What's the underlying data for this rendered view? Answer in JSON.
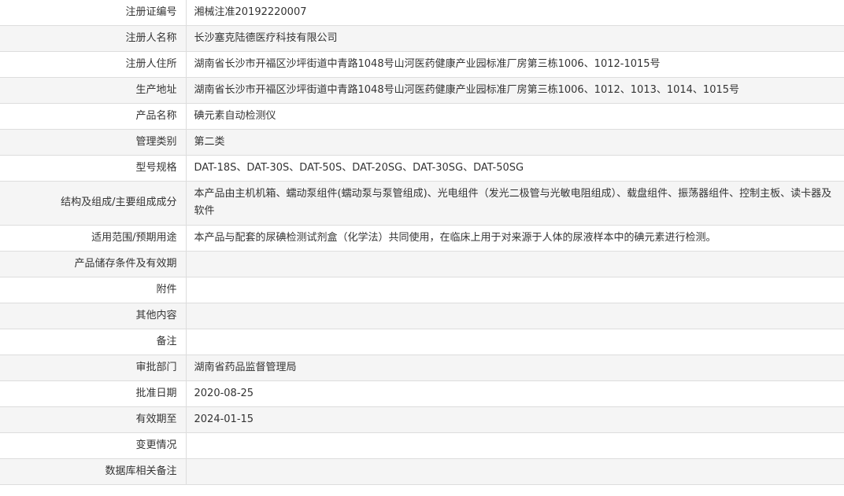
{
  "rows": [
    {
      "label": "注册证编号",
      "value": "湘械注准20192220007"
    },
    {
      "label": "注册人名称",
      "value": "长沙塞克陆德医疗科技有限公司"
    },
    {
      "label": "注册人住所",
      "value": "湖南省长沙市开福区沙坪街道中青路1048号山河医药健康产业园标准厂房第三栋1006、1012-1015号"
    },
    {
      "label": "生产地址",
      "value": "湖南省长沙市开福区沙坪街道中青路1048号山河医药健康产业园标准厂房第三栋1006、1012、1013、1014、1015号"
    },
    {
      "label": "产品名称",
      "value": "碘元素自动检测仪"
    },
    {
      "label": "管理类别",
      "value": "第二类"
    },
    {
      "label": "型号规格",
      "value": "DAT-18S、DAT-30S、DAT-50S、DAT-20SG、DAT-30SG、DAT-50SG"
    },
    {
      "label": "结构及组成/主要组成成分",
      "value": "本产品由主机机箱、蠕动泵组件(蠕动泵与泵管组成)、光电组件（发光二极管与光敏电阻组成）、载盘组件、振荡器组件、控制主板、读卡器及软件"
    },
    {
      "label": "适用范围/预期用途",
      "value": "本产品与配套的尿碘检测试剂盒（化学法）共同使用，在临床上用于对来源于人体的尿液样本中的碘元素进行检测。"
    },
    {
      "label": "产品储存条件及有效期",
      "value": ""
    },
    {
      "label": "附件",
      "value": ""
    },
    {
      "label": "其他内容",
      "value": ""
    },
    {
      "label": "备注",
      "value": ""
    },
    {
      "label": "审批部门",
      "value": "湖南省药品监督管理局"
    },
    {
      "label": "批准日期",
      "value": "2020-08-25"
    },
    {
      "label": "有效期至",
      "value": "2024-01-15"
    },
    {
      "label": "变更情况",
      "value": ""
    },
    {
      "label": "数据库相关备注",
      "value": ""
    }
  ]
}
